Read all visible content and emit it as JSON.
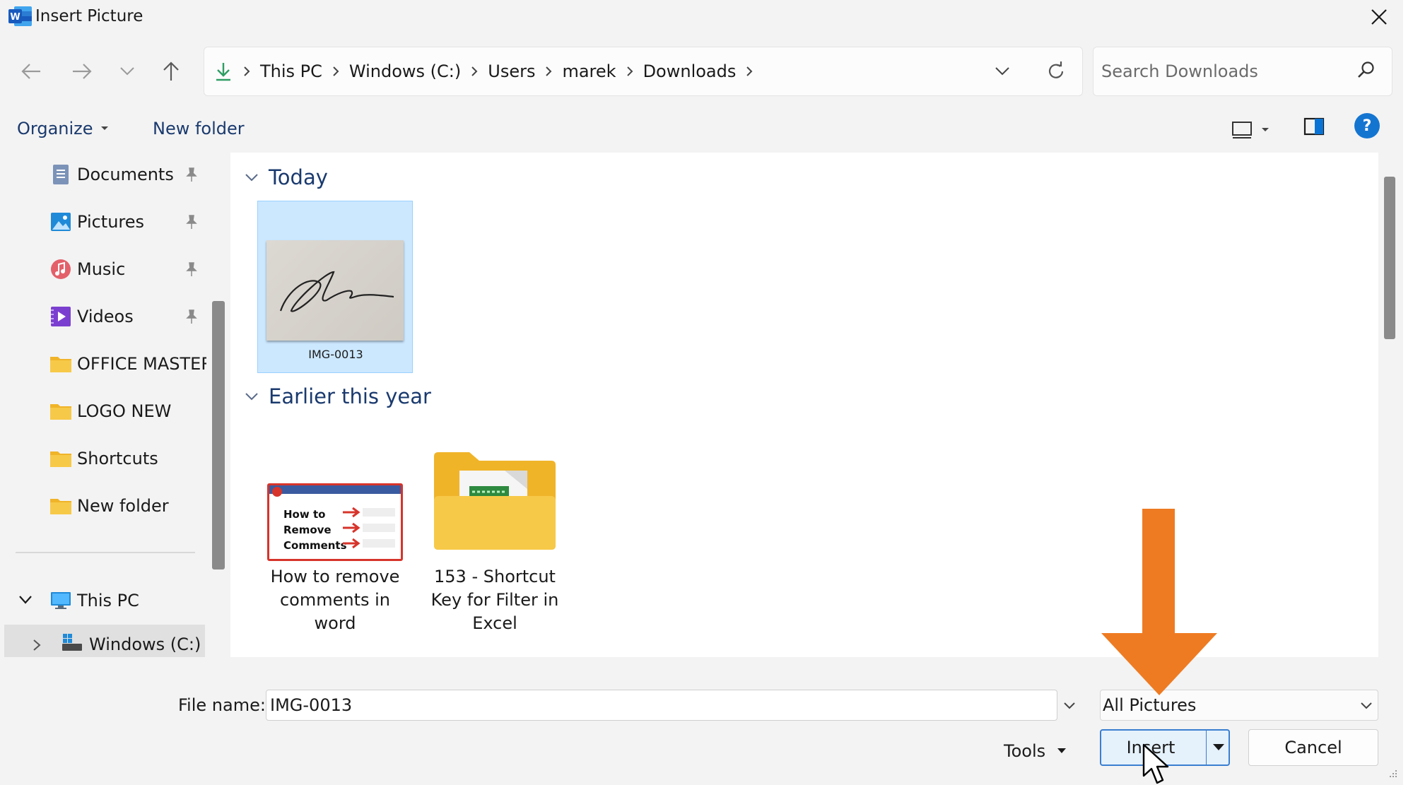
{
  "window": {
    "title": "Insert Picture",
    "app_icon_letter": "W"
  },
  "nav": {
    "breadcrumbs": [
      "This PC",
      "Windows (C:)",
      "Users",
      "marek",
      "Downloads"
    ],
    "search_placeholder": "Search Downloads"
  },
  "command_bar": {
    "organize_label": "Organize",
    "new_folder_label": "New folder",
    "help_glyph": "?"
  },
  "sidebar": {
    "items": [
      {
        "label": "Documents",
        "icon": "documents-icon",
        "pinned": true
      },
      {
        "label": "Pictures",
        "icon": "pictures-icon",
        "pinned": true
      },
      {
        "label": "Music",
        "icon": "music-icon",
        "pinned": true
      },
      {
        "label": "Videos",
        "icon": "videos-icon",
        "pinned": true
      },
      {
        "label": "OFFICE MASTER",
        "icon": "folder-icon",
        "pinned": false
      },
      {
        "label": "LOGO NEW",
        "icon": "folder-icon",
        "pinned": false
      },
      {
        "label": "Shortcuts",
        "icon": "folder-icon",
        "pinned": false
      },
      {
        "label": "New folder",
        "icon": "folder-icon",
        "pinned": false
      }
    ],
    "this_pc": "This PC",
    "drive": "Windows (C:)"
  },
  "content": {
    "groups": [
      {
        "header": "Today",
        "files": [
          {
            "name": "IMG-0013",
            "selected": true
          }
        ]
      },
      {
        "header": "Earlier this year",
        "files": [
          {
            "name": "How to remove comments in word",
            "selected": false
          },
          {
            "name": "153 - Shortcut Key for Filter in Excel",
            "selected": false
          }
        ]
      }
    ],
    "thumbnail_text": {
      "line1": "How to",
      "line2": "Remove",
      "line3": "Comments"
    }
  },
  "footer": {
    "file_name_label": "File name:",
    "file_name_value": "IMG-0013",
    "file_type": "All Pictures",
    "tools_label": "Tools",
    "insert_label": "Insert",
    "cancel_label": "Cancel"
  },
  "colors": {
    "accent": "#0067c0",
    "selection": "#cce8ff",
    "annotation_arrow": "#ee7b22",
    "folder": "#f7c542"
  }
}
